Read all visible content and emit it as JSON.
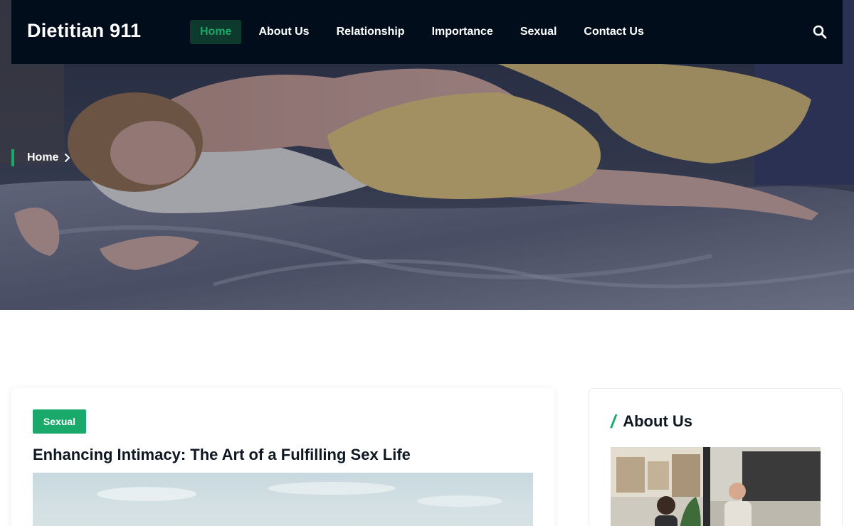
{
  "header": {
    "logo": "Dietitian 911",
    "nav": [
      {
        "label": "Home",
        "active": true
      },
      {
        "label": "About Us",
        "active": false
      },
      {
        "label": "Relationship",
        "active": false
      },
      {
        "label": "Importance",
        "active": false
      },
      {
        "label": "Sexual",
        "active": false
      },
      {
        "label": "Contact Us",
        "active": false
      }
    ],
    "search_icon": "search-icon"
  },
  "hero": {
    "breadcrumb": {
      "label": "Home",
      "chevron_icon": "chevron-right-icon"
    }
  },
  "post": {
    "category": "Sexual",
    "title": "Enhancing Intimacy: The Art of a Fulfilling Sex Life"
  },
  "sidebar": {
    "widget_title": "About Us"
  },
  "colors": {
    "accent": "#19a96b",
    "header_bg": "#020d1b",
    "active_nav_bg": "#0d3a2c",
    "title_text": "#0f1822"
  }
}
